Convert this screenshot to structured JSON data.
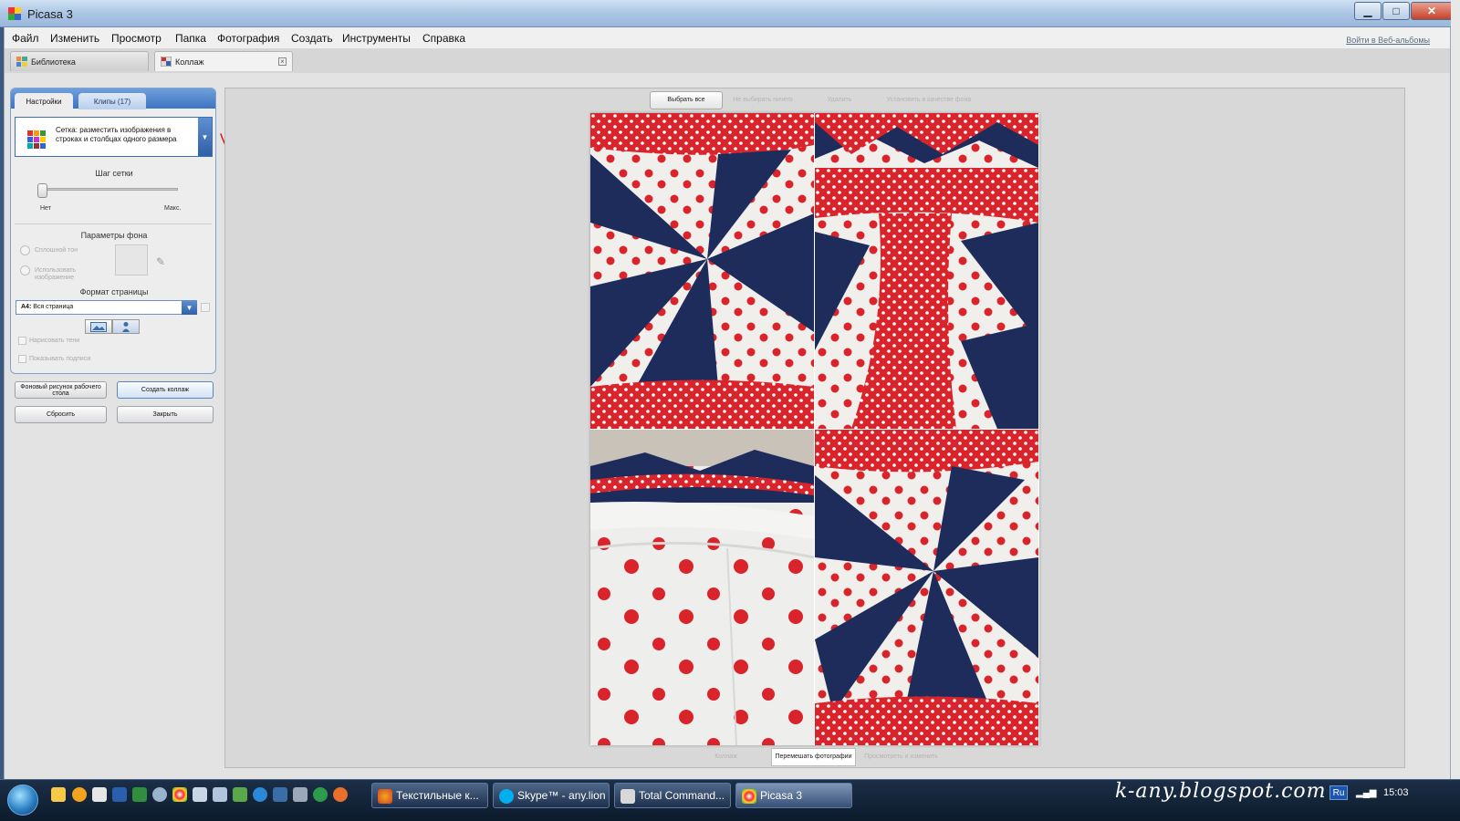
{
  "window": {
    "title": "Picasa 3",
    "min": "▁",
    "max": "□",
    "close": "✕"
  },
  "menu": {
    "items": [
      "Файл",
      "Изменить",
      "Просмотр",
      "Папка",
      "Фотография",
      "Создать",
      "Инструменты",
      "Справка"
    ],
    "web_link": "Войти в Веб-альбомы"
  },
  "tabs": [
    {
      "label": "Библиотека"
    },
    {
      "label": "Коллаж"
    }
  ],
  "left_panel": {
    "tab_settings": "Настройки",
    "tab_clips": "Клипы (17)",
    "layout_value": "Сетка: разместить изображения в строках и столбцах одного размера",
    "grid_step_label": "Шаг сетки",
    "grid_step_level": 0,
    "slider_min_label": "Нет",
    "slider_max_label": "Макс.",
    "bg_params_label": "Параметры фона",
    "bg_solid": "Сплошной тон",
    "bg_image": "Использовать изображение",
    "page_format_label": "Формат страницы",
    "page_format_bold": "A4:",
    "page_format_value": "Вся страница",
    "draw_shadows": "Нарисовать тени",
    "show_captions": "Показывать подписи",
    "btn_desktop_bg": "Фоновый рисунок рабочего стола",
    "btn_create": "Создать коллаж",
    "btn_reset": "Сбросить",
    "btn_close": "Закрыть"
  },
  "canvas_toolbar": {
    "select_all": "Выбрать все",
    "select_none": "Не выбирать ничего",
    "delete": "Удалить",
    "set_bg": "Установить в качестве фона"
  },
  "bottom_tabs": {
    "collage": "Коллаж",
    "shuffle": "Перемешать фотографии",
    "preview": "Просмотреть и изменить"
  },
  "taskbar": {
    "tasks": [
      "Текстильные к...",
      "Skype™ - any.lion",
      "Total Command...",
      "Picasa 3"
    ],
    "watermark": "k-any.blogspot.com",
    "lang": "Ru",
    "time": "15:03"
  },
  "colors": {
    "accent_blue": "#3d74c0",
    "polka_red": "#d9242b",
    "navy": "#1e2c5c"
  }
}
